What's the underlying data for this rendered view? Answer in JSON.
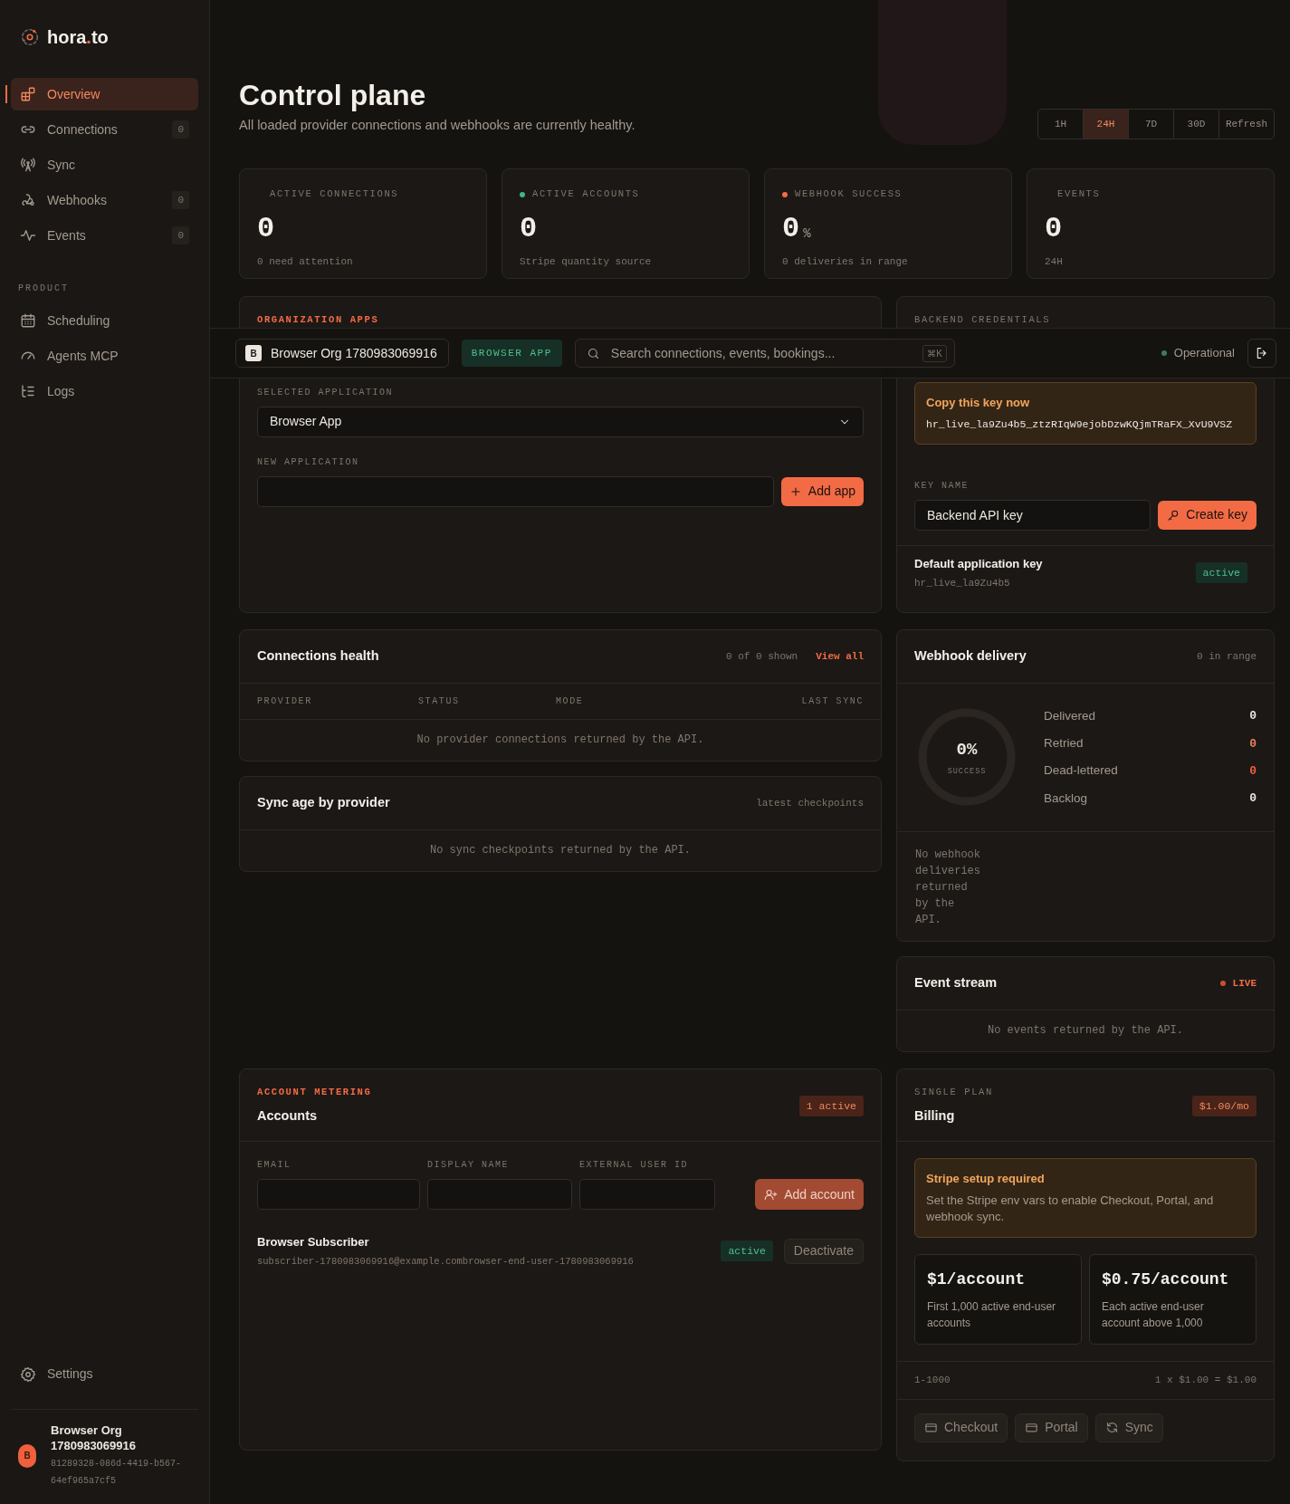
{
  "brand": {
    "start": "hora",
    "dot": ".",
    "end": "to"
  },
  "sidebar": {
    "nav": [
      {
        "label": "Overview",
        "selected": true
      },
      {
        "label": "Connections",
        "selected": false,
        "count": "0"
      },
      {
        "label": "Sync",
        "selected": false
      },
      {
        "label": "Webhooks",
        "selected": false,
        "count": "0"
      },
      {
        "label": "Events",
        "selected": false,
        "count": "0"
      }
    ],
    "section_label": "PRODUCT",
    "product": [
      {
        "label": "Scheduling",
        "selected": false
      },
      {
        "label": "Agents MCP",
        "selected": false
      },
      {
        "label": "Logs",
        "selected": false
      }
    ],
    "settings": "Settings",
    "org": {
      "initial": "B",
      "name": "Browser Org 1780983069916",
      "id": "81289328-086d-4419-b567-64ef965a7cf5"
    }
  },
  "topbar": {
    "org_initial": "B",
    "org_label": "Browser Org 1780983069916",
    "app_badge": "BROWSER APP",
    "search_placeholder": "Search connections, events, bookings...",
    "shortcut": "⌘K",
    "status": "Operational"
  },
  "header": {
    "title": "Control plane",
    "subtitle": "All loaded provider connections and webhooks are currently healthy.",
    "ranges": [
      {
        "label": "1H",
        "selected": false
      },
      {
        "label": "24H",
        "selected": true
      },
      {
        "label": "7D",
        "selected": false
      },
      {
        "label": "30D",
        "selected": false
      }
    ],
    "refresh": "Refresh"
  },
  "stats": [
    {
      "label": "ACTIVE CONNECTIONS",
      "value": "0",
      "caption": "0 need attention"
    },
    {
      "label": "ACTIVE ACCOUNTS",
      "value": "0",
      "caption": "Stripe quantity source",
      "color": "#3fb68b"
    },
    {
      "label": "WEBHOOK SUCCESS",
      "value": "0",
      "unit": "%",
      "caption": "0 deliveries in range",
      "color": "#f26b45"
    },
    {
      "label": "EVENTS",
      "value": "0",
      "caption": "24H"
    }
  ],
  "org_apps": {
    "eyebrow": "ORGANIZATION APPS",
    "selected_label": "SELECTED APPLICATION",
    "selected_value": "Browser App",
    "new_label": "NEW APPLICATION",
    "add_button": "Add app"
  },
  "credentials": {
    "eyebrow": "BACKEND CREDENTIALS",
    "notice_title": "Copy this key now",
    "notice_key": "hr_live_la9Zu4b5_ztzRIqW9ejobDzwKQjmTRaFX_XvU9VSZ",
    "key_label": "KEY NAME",
    "key_value": "Backend API key",
    "create_button": "Create key",
    "keys": [
      {
        "name": "Default application key",
        "prefix": "hr_live_la9Zu4b5",
        "status": "active"
      }
    ]
  },
  "connections_health": {
    "title": "Connections health",
    "count": "0 of 0 shown",
    "link": "View all",
    "columns": [
      "PROVIDER",
      "STATUS",
      "MODE",
      "LAST SYNC"
    ],
    "empty": "No provider connections returned by the API."
  },
  "sync_age": {
    "title": "Sync age by provider",
    "note": "latest checkpoints",
    "empty": "No sync checkpoints returned by the API."
  },
  "webhook_delivery": {
    "title": "Webhook delivery",
    "note": "0 in range",
    "gauge": {
      "value": "0%",
      "label": "SUCCESS",
      "level": 0
    },
    "stats": [
      {
        "label": "Delivered",
        "value": "0",
        "color": "#ece6df"
      },
      {
        "label": "Retried",
        "value": "0",
        "color": "#e8845a"
      },
      {
        "label": "Dead-lettered",
        "value": "0",
        "color": "#f0603c"
      },
      {
        "label": "Backlog",
        "value": "0",
        "color": "#ece6df"
      }
    ],
    "empty": "No webhook deliveries returned by the API."
  },
  "event_stream": {
    "title": "Event stream",
    "live": "LIVE",
    "empty": "No events returned by the API."
  },
  "accounts": {
    "eyebrow": "ACCOUNT METERING",
    "title": "Accounts",
    "badge": "1 active",
    "fields": [
      "EMAIL",
      "DISPLAY NAME",
      "EXTERNAL USER ID"
    ],
    "add_button": "Add account",
    "rows": [
      {
        "name": "Browser Subscriber",
        "detail": "subscriber-1780983069916@example.combrowser-end-user-1780983069916",
        "status": "active",
        "action": "Deactivate"
      }
    ]
  },
  "billing": {
    "eyebrow": "SINGLE PLAN",
    "title": "Billing",
    "badge": "$1.00/mo",
    "notice_title": "Stripe setup required",
    "notice_text": "Set the Stripe env vars to enable Checkout, Portal, and webhook sync.",
    "tiers": [
      {
        "price": "$1/account",
        "desc": "First 1,000 active end-user accounts"
      },
      {
        "price": "$0.75/account",
        "desc": "Each active end-user account above 1,000"
      }
    ],
    "tier_range": "1-1000",
    "tier_calc": "1 x $1.00 = $1.00",
    "actions": [
      "Checkout",
      "Portal",
      "Sync"
    ]
  }
}
